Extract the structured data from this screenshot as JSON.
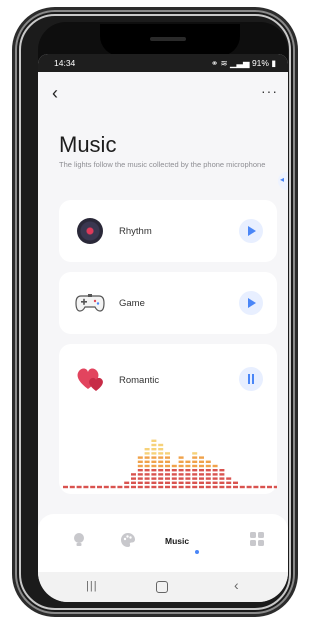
{
  "status_bar": {
    "time": "14:34",
    "battery": "91%"
  },
  "header": {
    "title": "Music",
    "subtitle": "The lights follow the music collected by the phone microphone"
  },
  "modes": [
    {
      "label": "Rhythm",
      "icon": "vinyl-record-icon",
      "state": "play"
    },
    {
      "label": "Game",
      "icon": "game-controller-icon",
      "state": "play"
    },
    {
      "label": "Romantic",
      "icon": "hearts-icon",
      "state": "pause"
    }
  ],
  "bottom_nav": [
    {
      "label": "",
      "icon": "bulb-icon"
    },
    {
      "label": "",
      "icon": "palette-icon"
    },
    {
      "label": "Music",
      "icon": "",
      "active": true
    },
    {
      "label": "",
      "icon": "grid-icon"
    }
  ],
  "colors": {
    "accent": "#4a86f7",
    "background": "#f6f6f8",
    "card": "#ffffff"
  }
}
